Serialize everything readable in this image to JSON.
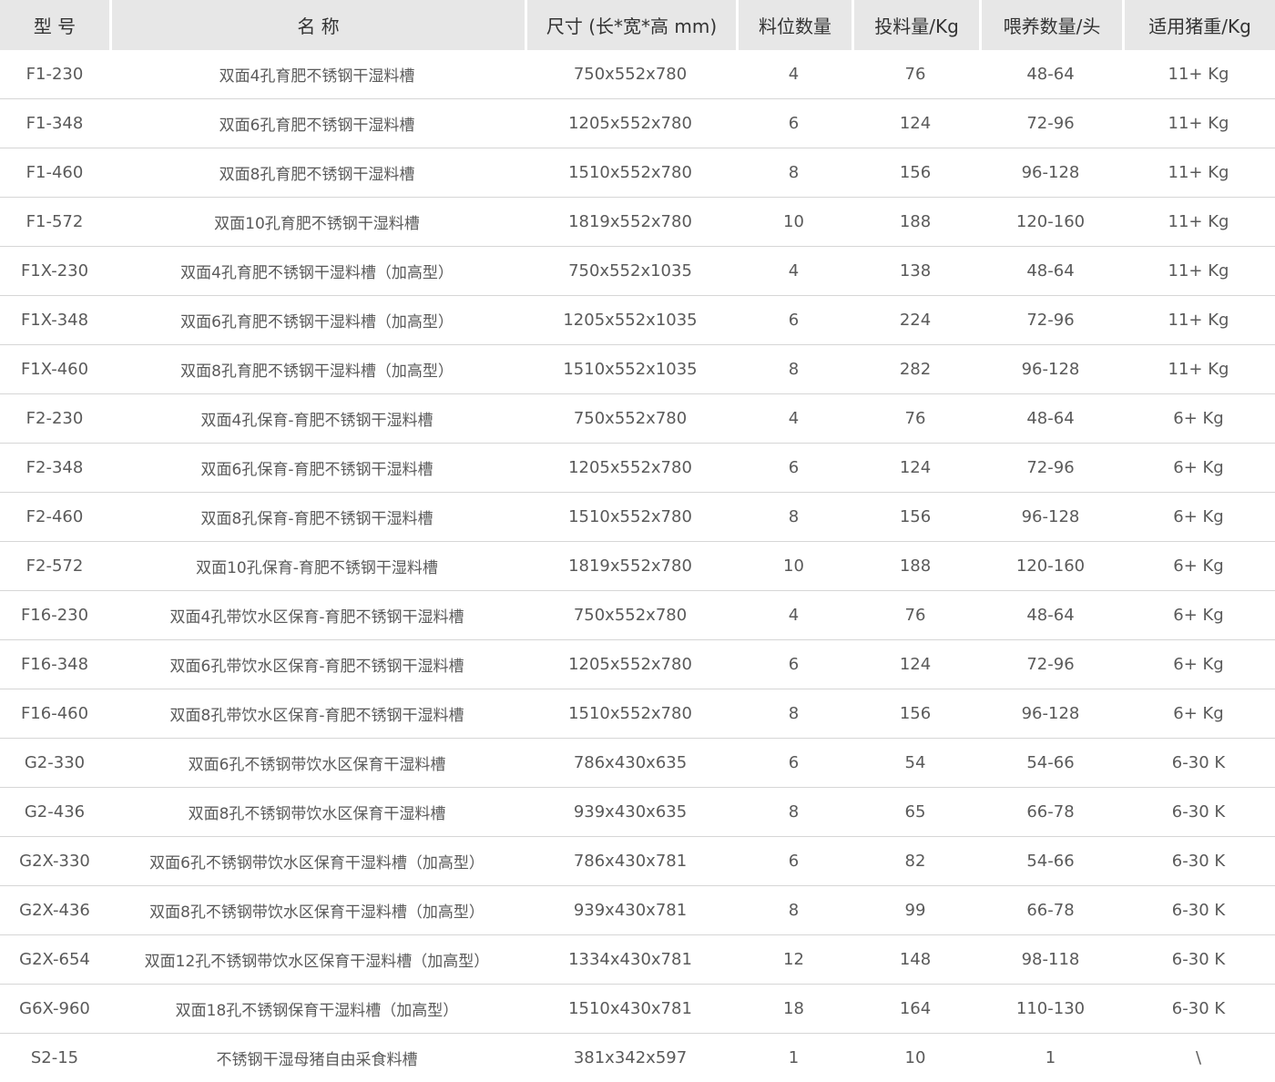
{
  "table": {
    "headers": [
      "型 号",
      "名 称",
      "尺寸 (长*宽*高 mm)",
      "料位数量",
      "投料量/Kg",
      "喂养数量/头",
      "适用猪重/Kg"
    ],
    "rows": [
      [
        "F1-230",
        "双面4孔育肥不锈钢干湿料槽",
        "750x552x780",
        "4",
        "76",
        "48-64",
        "11+ Kg"
      ],
      [
        "F1-348",
        "双面6孔育肥不锈钢干湿料槽",
        "1205x552x780",
        "6",
        "124",
        "72-96",
        "11+ Kg"
      ],
      [
        "F1-460",
        "双面8孔育肥不锈钢干湿料槽",
        "1510x552x780",
        "8",
        "156",
        "96-128",
        "11+ Kg"
      ],
      [
        "F1-572",
        "双面10孔育肥不锈钢干湿料槽",
        "1819x552x780",
        "10",
        "188",
        "120-160",
        "11+ Kg"
      ],
      [
        "F1X-230",
        "双面4孔育肥不锈钢干湿料槽（加高型）",
        "750x552x1035",
        "4",
        "138",
        "48-64",
        "11+ Kg"
      ],
      [
        "F1X-348",
        "双面6孔育肥不锈钢干湿料槽（加高型）",
        "1205x552x1035",
        "6",
        "224",
        "72-96",
        "11+ Kg"
      ],
      [
        "F1X-460",
        "双面8孔育肥不锈钢干湿料槽（加高型）",
        "1510x552x1035",
        "8",
        "282",
        "96-128",
        "11+ Kg"
      ],
      [
        "F2-230",
        "双面4孔保育-育肥不锈钢干湿料槽",
        "750x552x780",
        "4",
        "76",
        "48-64",
        "6+ Kg"
      ],
      [
        "F2-348",
        "双面6孔保育-育肥不锈钢干湿料槽",
        "1205x552x780",
        "6",
        "124",
        "72-96",
        "6+ Kg"
      ],
      [
        "F2-460",
        "双面8孔保育-育肥不锈钢干湿料槽",
        "1510x552x780",
        "8",
        "156",
        "96-128",
        "6+ Kg"
      ],
      [
        "F2-572",
        "双面10孔保育-育肥不锈钢干湿料槽",
        "1819x552x780",
        "10",
        "188",
        "120-160",
        "6+ Kg"
      ],
      [
        "F16-230",
        "双面4孔带饮水区保育-育肥不锈钢干湿料槽",
        "750x552x780",
        "4",
        "76",
        "48-64",
        "6+ Kg"
      ],
      [
        "F16-348",
        "双面6孔带饮水区保育-育肥不锈钢干湿料槽",
        "1205x552x780",
        "6",
        "124",
        "72-96",
        "6+ Kg"
      ],
      [
        "F16-460",
        "双面8孔带饮水区保育-育肥不锈钢干湿料槽",
        "1510x552x780",
        "8",
        "156",
        "96-128",
        "6+ Kg"
      ],
      [
        "G2-330",
        "双面6孔不锈钢带饮水区保育干湿料槽",
        "786x430x635",
        "6",
        "54",
        "54-66",
        "6-30 K"
      ],
      [
        "G2-436",
        "双面8孔不锈钢带饮水区保育干湿料槽",
        "939x430x635",
        "8",
        "65",
        "66-78",
        "6-30 K"
      ],
      [
        "G2X-330",
        "双面6孔不锈钢带饮水区保育干湿料槽（加高型）",
        "786x430x781",
        "6",
        "82",
        "54-66",
        "6-30 K"
      ],
      [
        "G2X-436",
        "双面8孔不锈钢带饮水区保育干湿料槽（加高型）",
        "939x430x781",
        "8",
        "99",
        "66-78",
        "6-30 K"
      ],
      [
        "G2X-654",
        "双面12孔不锈钢带饮水区保育干湿料槽（加高型）",
        "1334x430x781",
        "12",
        "148",
        "98-118",
        "6-30 K"
      ],
      [
        "G6X-960",
        "双面18孔不锈钢保育干湿料槽（加高型）",
        "1510x430x781",
        "18",
        "164",
        "110-130",
        "6-30 K"
      ],
      [
        "S2-15",
        "不锈钢干湿母猪自由采食料槽",
        "381x342x597",
        "1",
        "10",
        "1",
        "\\"
      ]
    ]
  }
}
